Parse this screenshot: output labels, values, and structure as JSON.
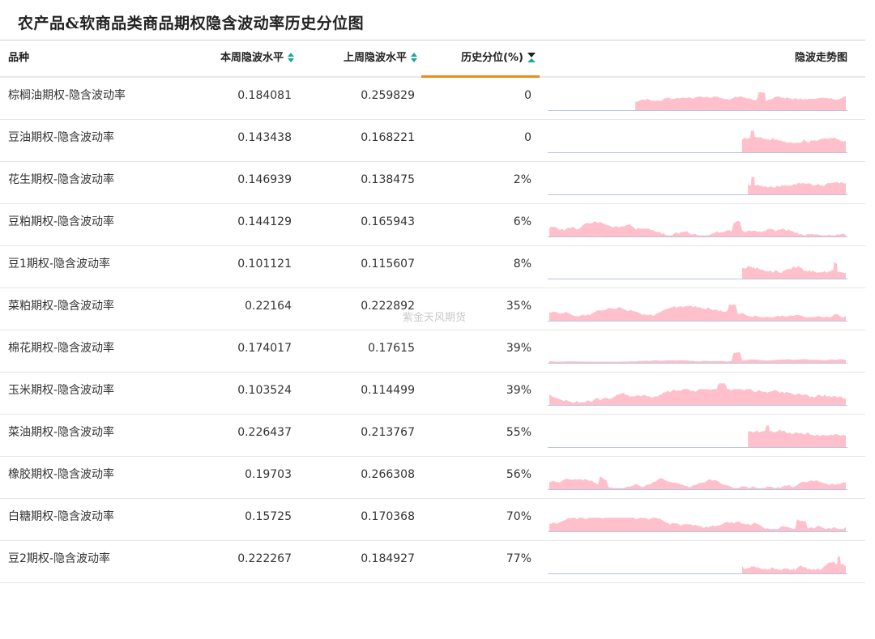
{
  "page": {
    "title": "农产品&软商品类商品期权隐含波动率历史分位图",
    "watermark": "紫金天风期货"
  },
  "header": {
    "name": "品种",
    "current_week": "本周隐波水平",
    "last_week": "上周隐波水平",
    "percentile": "历史分位(%)",
    "trend": "隐波走势图"
  },
  "colors": {
    "accent_orange": "#ef8a1f",
    "sort_teal": "#1aa89a",
    "sort_active": "#222222",
    "spark_fill": "#ffc0cb",
    "spark_base": "#b9c4e0"
  },
  "rows": [
    {
      "name": "棕榈油期权-隐含波动率",
      "current": "0.184081",
      "last": "0.259829",
      "percentile": "0"
    },
    {
      "name": "豆油期权-隐含波动率",
      "current": "0.143438",
      "last": "0.168221",
      "percentile": "0"
    },
    {
      "name": "花生期权-隐含波动率",
      "current": "0.146939",
      "last": "0.138475",
      "percentile": "2%"
    },
    {
      "name": "豆粕期权-隐含波动率",
      "current": "0.144129",
      "last": "0.165943",
      "percentile": "6%"
    },
    {
      "name": "豆1期权-隐含波动率",
      "current": "0.101121",
      "last": "0.115607",
      "percentile": "8%"
    },
    {
      "name": "菜粕期权-隐含波动率",
      "current": "0.22164",
      "last": "0.222892",
      "percentile": "35%"
    },
    {
      "name": "棉花期权-隐含波动率",
      "current": "0.174017",
      "last": "0.17615",
      "percentile": "39%"
    },
    {
      "name": "玉米期权-隐含波动率",
      "current": "0.103524",
      "last": "0.114499",
      "percentile": "39%"
    },
    {
      "name": "菜油期权-隐含波动率",
      "current": "0.226437",
      "last": "0.213767",
      "percentile": "55%"
    },
    {
      "name": "橡胶期权-隐含波动率",
      "current": "0.19703",
      "last": "0.266308",
      "percentile": "56%"
    },
    {
      "name": "白糖期权-隐含波动率",
      "current": "0.15725",
      "last": "0.170368",
      "percentile": "70%"
    },
    {
      "name": "豆2期权-隐含波动率",
      "current": "0.222267",
      "last": "0.184927",
      "percentile": "77%"
    }
  ]
}
